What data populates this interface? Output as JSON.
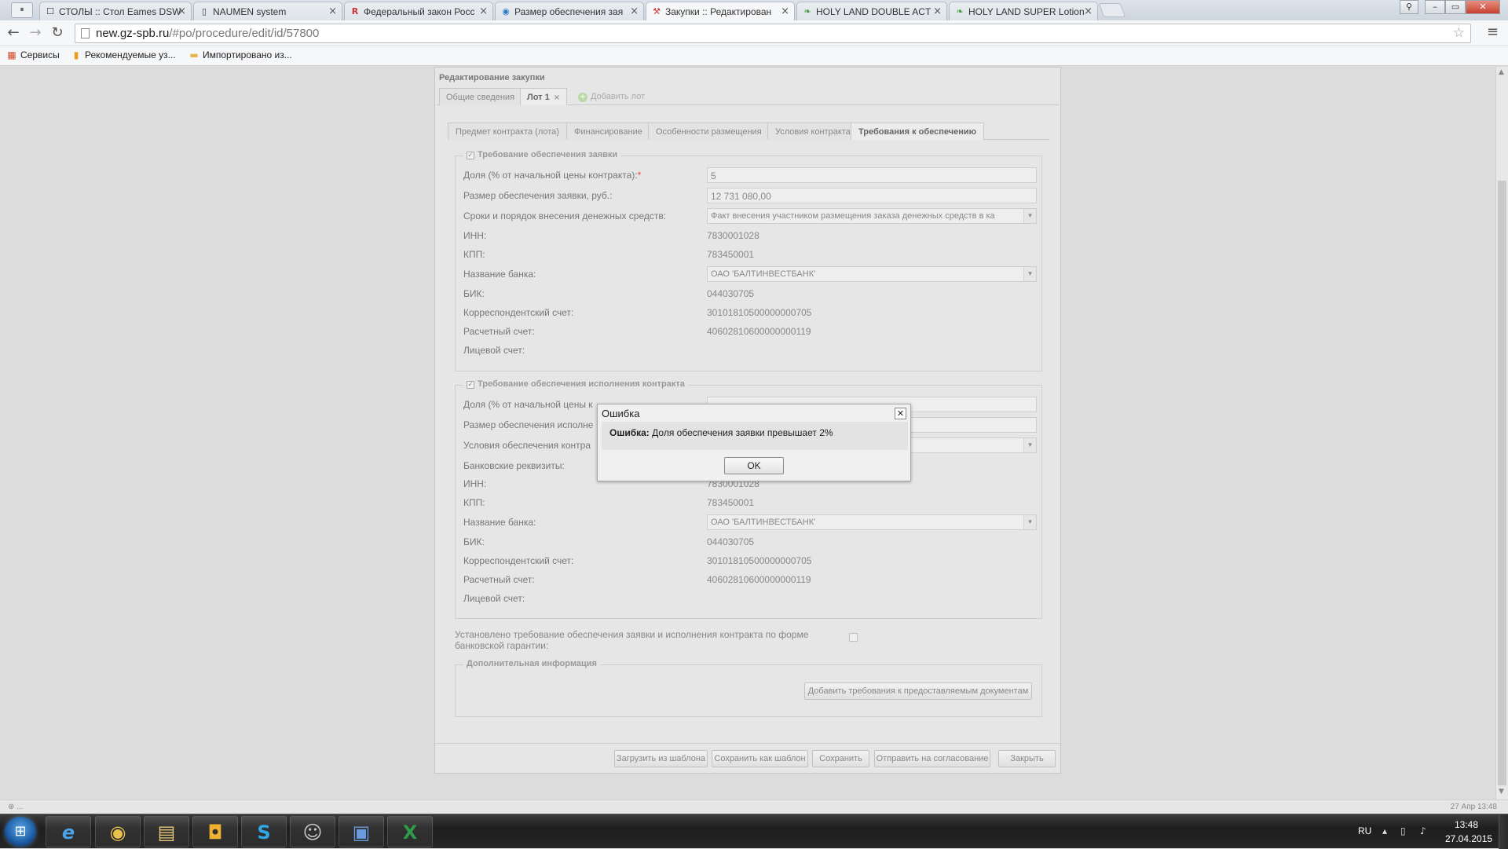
{
  "browser": {
    "pause_glyph": "⏸",
    "tabs": [
      {
        "title": "СТОЛЫ :: Стол Eames DSW",
        "icon": "☐"
      },
      {
        "title": "NAUMEN system",
        "icon": "▯"
      },
      {
        "title": "Федеральный закон Росс",
        "icon": "R"
      },
      {
        "title": "Размер обеспечения зая",
        "icon": "◉"
      },
      {
        "title": "Закупки :: Редактирован",
        "icon": "⚒"
      },
      {
        "title": "HOLY LAND DOUBLE ACT",
        "icon": "❧"
      },
      {
        "title": "HOLY LAND SUPER Lotion",
        "icon": "❧"
      }
    ],
    "close_glyph": "×",
    "window_controls": {
      "user": "⚲",
      "minimize": "–",
      "maximize": "▭",
      "close": "✕"
    },
    "nav": {
      "back": "←",
      "forward": "→",
      "reload": "↻"
    },
    "url_host": "new.gz-spb.ru",
    "url_path": "/#po/procedure/edit/id/57800",
    "star_glyph": "☆",
    "menu_glyph": "≡",
    "bookmarks": [
      {
        "label": "Сервисы",
        "icon": "▦",
        "color": "#d04a2a"
      },
      {
        "label": "Рекомендуемые уз...",
        "icon": "▮",
        "color": "#f09a1a"
      },
      {
        "label": "Импортировано из...",
        "icon": "▬",
        "color": "#e8b64a"
      }
    ]
  },
  "form": {
    "title": "Редактирование закупки",
    "lot_tabs": [
      "Общие сведения",
      "Лот 1"
    ],
    "lot_close": "×",
    "add_lot": {
      "icon": "+",
      "label": "Добавить лот"
    },
    "sub_tabs": [
      "Предмет контракта (лота)",
      "Финансирование",
      "Особенности размещения",
      "Условия контракта",
      "Требования к обеспечению"
    ],
    "section1": {
      "legend": "Требование обеспечения заявки",
      "check": "✓",
      "share_label": "Доля (% от начальной цены контракта):",
      "required_mark": "*",
      "share_value": "5",
      "amount_label": "Размер обеспечения заявки, руб.:",
      "amount_value": "12 731 080,00",
      "terms_label": "Сроки и порядок внесения денежных средств:",
      "terms_value": "Факт внесения участником размещения заказа денежных средств в ка",
      "inn_label": "ИНН:",
      "inn_value": "7830001028",
      "kpp_label": "КПП:",
      "kpp_value": "783450001",
      "bank_label": "Название банка:",
      "bank_value": "ОАО 'БАЛТИНВЕСТБАНК'",
      "bik_label": "БИК:",
      "bik_value": "044030705",
      "corr_label": "Корреспондентский счет:",
      "corr_value": "30101810500000000705",
      "account_label": "Расчетный счет:",
      "account_value": "40602810600000000119",
      "personal_label": "Лицевой счет:"
    },
    "section2": {
      "legend": "Требование обеспечения исполнения контракта",
      "check": "✓",
      "share_label": "Доля (% от начальной цены к",
      "amount_label": "Размер обеспечения исполне",
      "conditions_label": "Условия обеспечения контра",
      "bank_details_label": "Банковские реквизиты:",
      "inn_label": "ИНН:",
      "inn_value": "7830001028",
      "kpp_label": "КПП:",
      "kpp_value": "783450001",
      "bank_label": "Название банка:",
      "bank_value": "ОАО 'БАЛТИНВЕСТБАНК'",
      "bik_label": "БИК:",
      "bik_value": "044030705",
      "corr_label": "Корреспондентский счет:",
      "corr_value": "30101810500000000705",
      "account_label": "Расчетный счет:",
      "account_value": "40602810600000000119",
      "personal_label": "Лицевой счет:"
    },
    "bank_guarantee_text": "Установлено требование обеспечения заявки и исполнения контракта по форме банковской гарантии:",
    "additional_info": {
      "legend": "Дополнительная информация",
      "add_docs_button": "Добавить требования к предоставляемым документам"
    },
    "select_arrow": "▾",
    "buttons": {
      "load_template": "Загрузить из шаблона",
      "save_template": "Сохранить как шаблон",
      "save": "Сохранить",
      "send_approval": "Отправить на согласование",
      "close": "Закрыть"
    }
  },
  "dialog": {
    "title": "Ошибка",
    "close_glyph": "✕",
    "message_prefix": "Ошибка:",
    "message": " Доля обеспечения заявки превышает 2%",
    "ok": "OK"
  },
  "statusbar": {
    "left": "⊕ ...",
    "right": "27 Апр 13:48"
  },
  "taskbar": {
    "start_glyph": "⊞",
    "apps": [
      {
        "name": "ie",
        "glyph": "e",
        "color": "#4aa3e8"
      },
      {
        "name": "chrome",
        "glyph": "◉",
        "color": "#e8c14a"
      },
      {
        "name": "explorer",
        "glyph": "▤",
        "color": "#e8c878"
      },
      {
        "name": "outlook",
        "glyph": "◘",
        "color": "#f0b030"
      },
      {
        "name": "skype",
        "glyph": "S",
        "color": "#2fa8e8"
      },
      {
        "name": "app-avatar",
        "glyph": "☺",
        "color": "#c8c8c8"
      },
      {
        "name": "remote-desktop",
        "glyph": "▣",
        "color": "#6a9ae0"
      },
      {
        "name": "excel",
        "glyph": "X",
        "color": "#2e9a4a"
      }
    ],
    "lang": "RU",
    "tray_arrow": "▴",
    "tray_network": "▯",
    "tray_volume": "♪",
    "time": "13:48",
    "date": "27.04.2015"
  }
}
